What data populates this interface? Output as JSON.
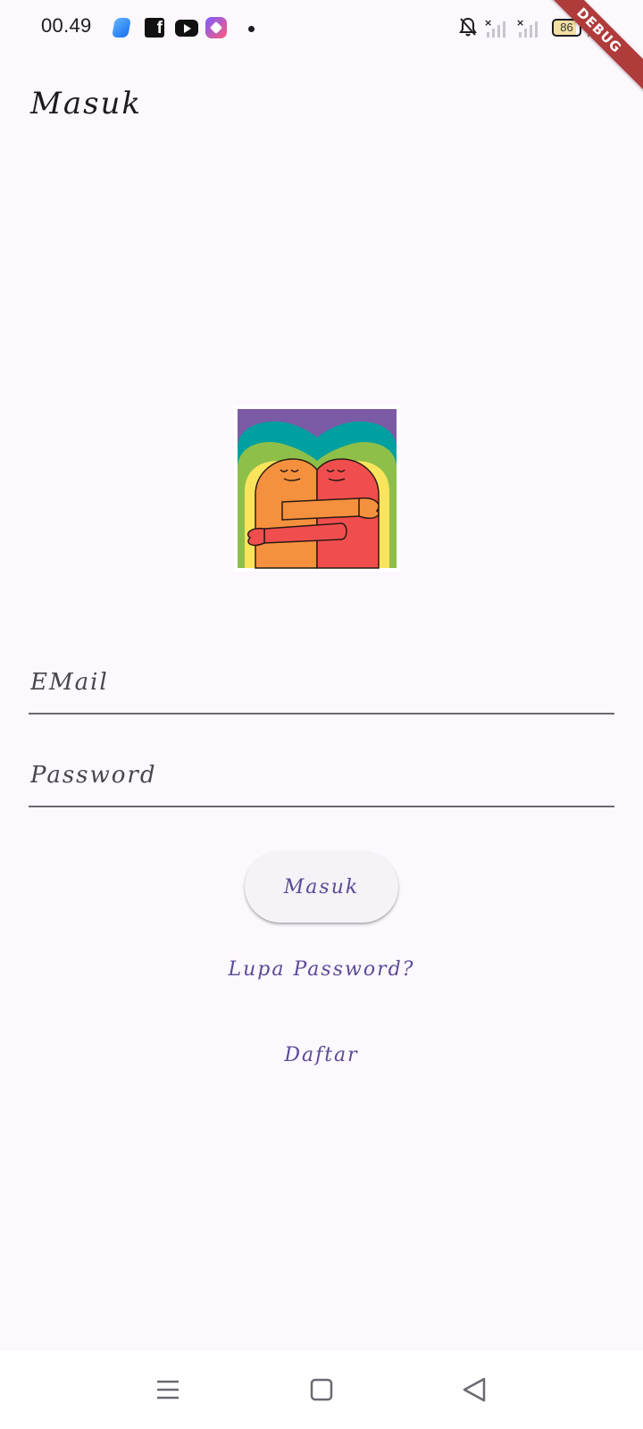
{
  "status_bar": {
    "time": "00.49",
    "battery_level": "86",
    "notification_icons": [
      "files-icon",
      "facebook-icon",
      "youtube-icon",
      "gem-app-icon",
      "more-dot-icon"
    ],
    "system_icons": [
      "bell-off-icon",
      "signal-icon",
      "signal-icon",
      "battery-icon",
      "charging-bolt-icon"
    ]
  },
  "debug_banner": "DEBUG",
  "app_bar": {
    "title": "Masuk"
  },
  "logo": {
    "icon": "hugging-couple-logo",
    "colors": {
      "purple": "#7b5aa6",
      "teal": "#00a0a0",
      "green": "#8ebf49",
      "yellow": "#f9e45c",
      "orange": "#f5913e",
      "red": "#f04e4e"
    }
  },
  "form": {
    "email_placeholder": "EMail",
    "password_placeholder": "Password",
    "login_button": "Masuk",
    "forgot_link": "Lupa Password?",
    "register_link": "Daftar"
  },
  "nav_bar": {
    "icons": [
      "menu-icon",
      "home-icon",
      "back-icon"
    ]
  },
  "theme": {
    "background": "#fdf7fe",
    "accent": "#5b4a96",
    "ribbon": "#b03b3b"
  }
}
